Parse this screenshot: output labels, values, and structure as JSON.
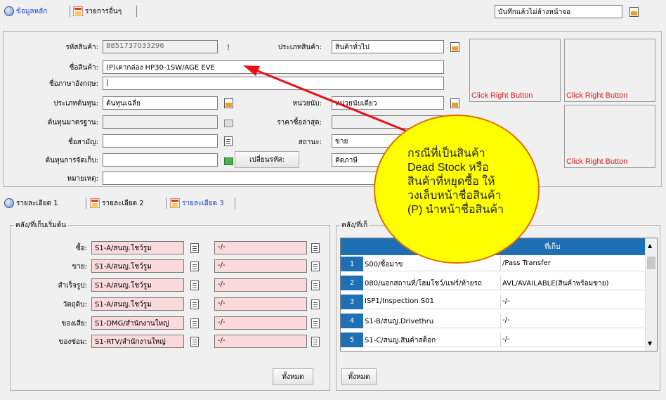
{
  "top_tabs": [
    {
      "label": "ข้อมูลหลัก",
      "active": true
    },
    {
      "label": "รายการอื่นๆ",
      "active": false
    }
  ],
  "save_mode": "บันทึกแล้วไม่ล้างหน้าจอ",
  "form": {
    "product_code_label": "รหัสสินค้า:",
    "product_code_value": "8851737033296",
    "warning_glyph": "!",
    "product_name_label": "ชื่อสินค้า:",
    "product_name_value": "(P)เตากล่อง HP30-1SW/AGE  EVE",
    "english_name_label": "ชื่อภาษาอังกฤษ:",
    "english_name_value": "|",
    "cost_type_label": "ประเภทต้นทุน:",
    "cost_type_value": "ต้นทุนเฉลี่ย",
    "standard_cost_label": "ต้นทุนมาตรฐาน:",
    "standard_cost_value": "",
    "common_name_label": "ชื่อสามัญ:",
    "common_name_value": "",
    "storage_cost_label": "ต้นทุนการจัดเก็บ:",
    "storage_cost_value": "",
    "remark_label": "หมายเหตุ:",
    "remark_value": "",
    "product_type_label": "ประเภทสินค้า:",
    "product_type_value": "สินค้าทั่วไป",
    "unit_label": "หน่วยนับ:",
    "unit_value": "หน่วยนับเดียว",
    "last_price_label": "ราคาซื้อล่าสุด:",
    "last_price_value": "",
    "status_label": "สถานะ:",
    "status_value": "ขาย",
    "tax_value": "คิดภาษี",
    "change_code_button": "เปลี่ยนรหัส:"
  },
  "image_boxes": [
    "Click Right Button",
    "Click Right Button",
    "Click Right Button"
  ],
  "detail_tabs": [
    {
      "label": "รายละเอียด 1",
      "active": false
    },
    {
      "label": "รายละเอียด 2",
      "active": false
    },
    {
      "label": "รายละเอียด 3",
      "active": true
    }
  ],
  "start_store": {
    "title": "คลัง/ที่เก็บเริ่มต้น",
    "rows": [
      {
        "label": "ซื้อ:",
        "store": "S1-A/สนญ.โชว์รูม",
        "location": "-/-"
      },
      {
        "label": "ขาย:",
        "store": "S1-A/สนญ.โชว์รูม",
        "location": "-/-"
      },
      {
        "label": "สำเร็จรูป:",
        "store": "S1-A/สนญ.โชว์รูม",
        "location": "-/-"
      },
      {
        "label": "วัตถุดิบ:",
        "store": "S1-A/สนญ.โชว์รูม",
        "location": "-/-"
      },
      {
        "label": "ของเสีย:",
        "store": "S1-DMG/สำนักงานใหญ่",
        "location": "-/-"
      },
      {
        "label": "ของซ่อม:",
        "store": "S1-RTV/สำนักงานใหญ่",
        "location": "-/-"
      }
    ],
    "all_button": "ทั้งหมด"
  },
  "store_grid": {
    "title": "คลัง/ที่เก็",
    "col_location_header": "ที่เก็บ",
    "rows": [
      {
        "num": "1",
        "store": "S00/ซื้อมาข",
        "location": "/Pass Transfer"
      },
      {
        "num": "2",
        "store": "080/นอกสถานที่/โฮมโชว์/แฟร์/ท้ายรถ",
        "location": "AVL/AVAILABLE(สินค้าพร้อมขาย)"
      },
      {
        "num": "3",
        "store": "ISP1/Inspection S01",
        "location": "-/-"
      },
      {
        "num": "4",
        "store": "S1-B/สนญ.Drivethru",
        "location": "-/-"
      },
      {
        "num": "5",
        "store": "S1-C/สนญ.สินค้าสต็อก",
        "location": "-/-"
      }
    ],
    "all_button": "ทั้งหมด"
  },
  "callout": {
    "lines": [
      "กรณีที่เป็นสินค้า",
      "Dead Stock  หรือ",
      "สินค้าที่หยุดซื้อ ให้",
      "วงเล็บหน้าชื่อสินค้า",
      "(P) นำหน้าชื่อสินค้า"
    ]
  },
  "colors": {
    "grid_header": "#1f6fb5",
    "callout_fill": "#ffff00",
    "arrow": "#e8101a",
    "image_hint": "#e0201a",
    "pink_field": "#fadadd"
  }
}
